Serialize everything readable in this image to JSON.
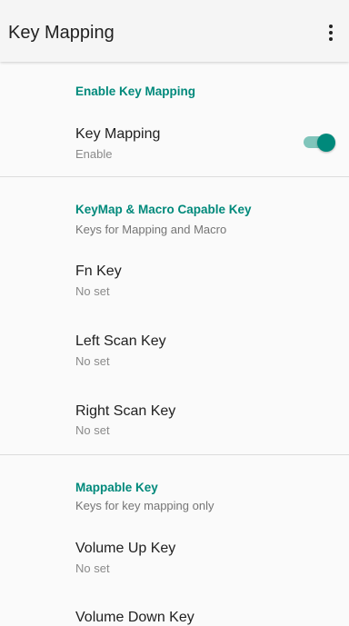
{
  "app_bar": {
    "title": "Key Mapping",
    "menu_icon": "more-vert-icon"
  },
  "sections": {
    "enable": {
      "header": "Enable Key Mapping",
      "items": [
        {
          "title": "Key Mapping",
          "summary": "Enable",
          "toggle_on": true
        }
      ]
    },
    "keymap_macro": {
      "header": "KeyMap & Macro Capable Key",
      "subtitle": "Keys for Mapping and Macro",
      "items": [
        {
          "title": "Fn Key",
          "summary": "No set"
        },
        {
          "title": "Left Scan Key",
          "summary": "No set"
        },
        {
          "title": "Right Scan Key",
          "summary": "No set"
        }
      ]
    },
    "mappable": {
      "header": "Mappable Key",
      "subtitle": "Keys for key mapping only",
      "items": [
        {
          "title": "Volume Up Key",
          "summary": "No set"
        },
        {
          "title": "Volume Down Key",
          "summary": ""
        }
      ]
    }
  },
  "colors": {
    "accent": "#00897b",
    "switch_track": "#80c5bb",
    "background": "#fafafa",
    "app_bar": "#f5f5f5"
  }
}
